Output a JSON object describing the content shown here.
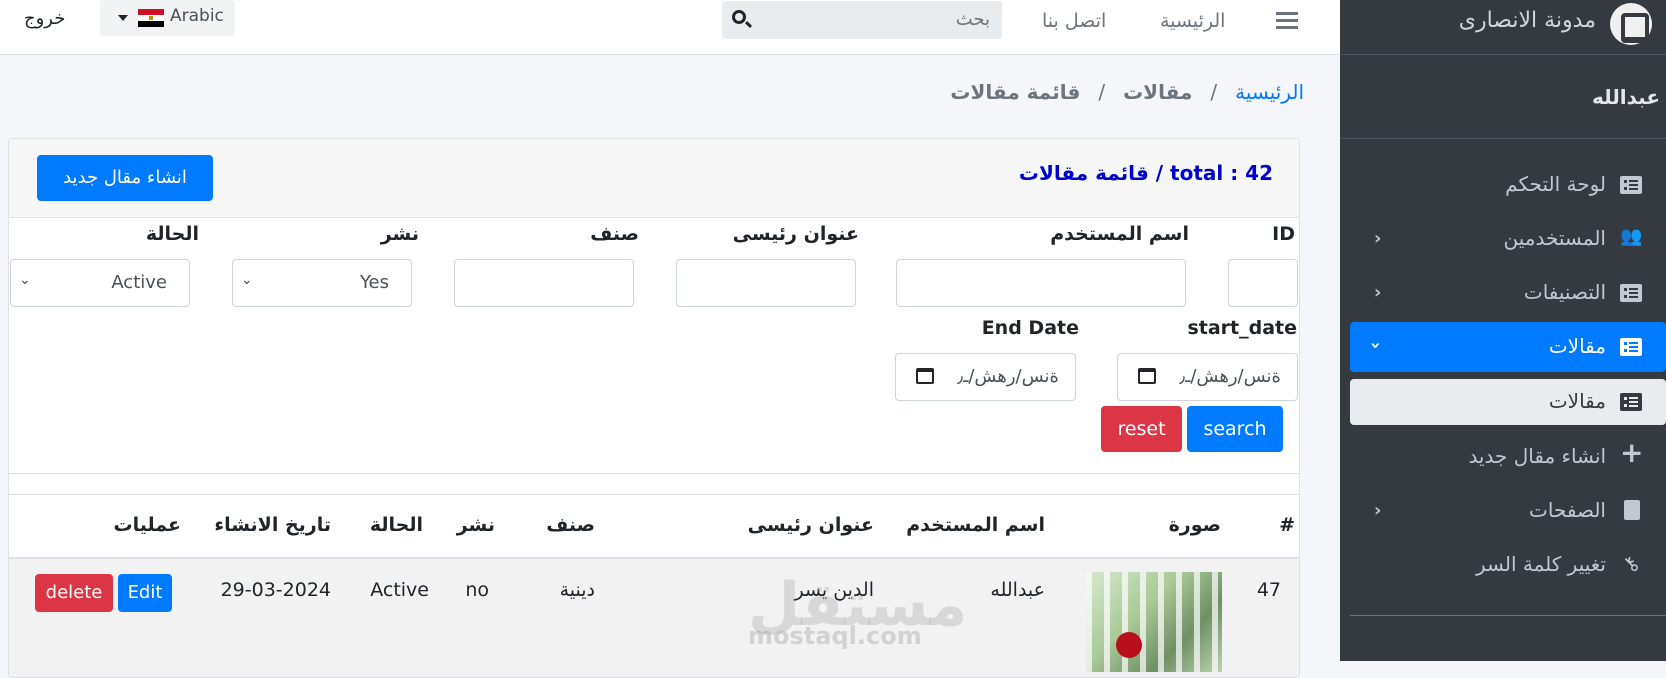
{
  "navbar": {
    "home_link": "الرئيسية",
    "contact_link": "اتصل بنا",
    "search_placeholder": "بحث",
    "language": "Arabic",
    "logout": "خروج"
  },
  "sidebar": {
    "brand": "مدونة الانصارى",
    "user_name": "عبدالله",
    "items": [
      {
        "label": "لوحة التحكم",
        "icon": "list-icon"
      },
      {
        "label": "المستخدمين",
        "icon": "users-icon"
      },
      {
        "label": "التصنيفات",
        "icon": "list-icon"
      },
      {
        "label": "مقالات",
        "icon": "list-icon"
      },
      {
        "label": "مقالات",
        "icon": "list-icon"
      },
      {
        "label": "انشاء مقال جديد",
        "icon": "plus-icon"
      },
      {
        "label": "الصفحات",
        "icon": "file-icon"
      },
      {
        "label": "تغيير كلمة السر",
        "icon": "key-icon"
      }
    ]
  },
  "breadcrumb": {
    "home": "الرئيسية",
    "articles": "مقالات",
    "current": "قائمة مقالات"
  },
  "card": {
    "title": "قائمة مقالات / total : 42",
    "create_button": "انشاء مقال جديد"
  },
  "filters": {
    "id_label": "ID",
    "username_label": "اسم المستخدم",
    "title_label": "عنوان رئيسى",
    "category_label": "صنف",
    "publish_label": "نشر",
    "publish_value": "Yes",
    "status_label": "الحالة",
    "status_value": "Active",
    "start_date_label": "start_date",
    "end_date_label": "End Date",
    "date_placeholder": "ةنس/رهش/ـ٫",
    "search_button": "search",
    "reset_button": "reset"
  },
  "table": {
    "headers": [
      "#",
      "صورة",
      "اسم المستخدم",
      "عنوان رئيسى",
      "صنف",
      "نشر",
      "الحالة",
      "تاريخ الانشاء",
      "عمليات"
    ],
    "rows": [
      {
        "id": "47",
        "username": "عبدالله",
        "title": "الدين يسر",
        "category": "دينية",
        "published": "no",
        "status": "Active",
        "created": "29-03-2024",
        "edit": "Edit",
        "delete": "delete"
      }
    ]
  },
  "watermark": {
    "arabic": "مستقل",
    "latin": "mostaql.com"
  },
  "colors": {
    "primary": "#007bff",
    "danger": "#dc3545",
    "sidebar": "#343a40",
    "title": "#0000cc"
  }
}
